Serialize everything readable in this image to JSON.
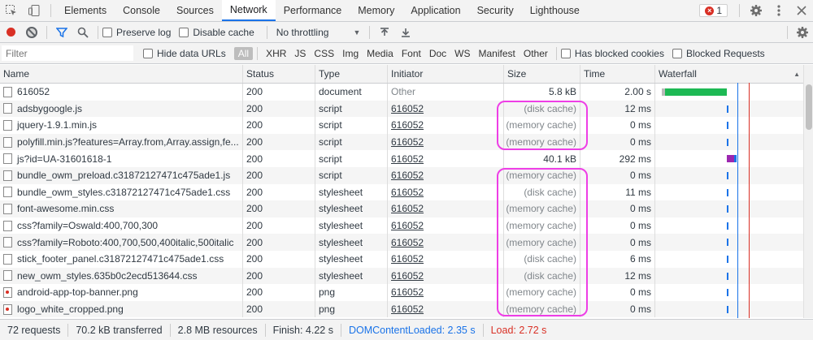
{
  "tabs": [
    "Elements",
    "Console",
    "Sources",
    "Network",
    "Performance",
    "Memory",
    "Application",
    "Security",
    "Lighthouse"
  ],
  "active_tab": "Network",
  "error_count": "1",
  "toolbar": {
    "preserve_log": "Preserve log",
    "disable_cache": "Disable cache",
    "throttling": "No throttling"
  },
  "filter": {
    "placeholder": "Filter",
    "hide_data_urls": "Hide data URLs",
    "types": [
      "All",
      "XHR",
      "JS",
      "CSS",
      "Img",
      "Media",
      "Font",
      "Doc",
      "WS",
      "Manifest",
      "Other"
    ],
    "has_blocked_cookies": "Has blocked cookies",
    "blocked_requests": "Blocked Requests"
  },
  "columns": {
    "name": "Name",
    "status": "Status",
    "type": "Type",
    "initiator": "Initiator",
    "size": "Size",
    "time": "Time",
    "waterfall": "Waterfall"
  },
  "requests": [
    {
      "name": "616052",
      "status": "200",
      "type": "document",
      "initiator": "Other",
      "size": "5.8 kB",
      "time": "2.00 s",
      "icon": "file-icon",
      "cached": false
    },
    {
      "name": "adsbygoogle.js",
      "status": "200",
      "type": "script",
      "initiator": "616052",
      "size": "(disk cache)",
      "time": "12 ms",
      "icon": "file-icon",
      "cached": true
    },
    {
      "name": "jquery-1.9.1.min.js",
      "status": "200",
      "type": "script",
      "initiator": "616052",
      "size": "(memory cache)",
      "time": "0 ms",
      "icon": "file-icon",
      "cached": true
    },
    {
      "name": "polyfill.min.js?features=Array.from,Array.assign,fe...",
      "status": "200",
      "type": "script",
      "initiator": "616052",
      "size": "(memory cache)",
      "time": "0 ms",
      "icon": "file-icon",
      "cached": true
    },
    {
      "name": "js?id=UA-31601618-1",
      "status": "200",
      "type": "script",
      "initiator": "616052",
      "size": "40.1 kB",
      "time": "292 ms",
      "icon": "file-icon",
      "cached": false
    },
    {
      "name": "bundle_owm_preload.c31872127471c475ade1.js",
      "status": "200",
      "type": "script",
      "initiator": "616052",
      "size": "(memory cache)",
      "time": "0 ms",
      "icon": "file-icon",
      "cached": true
    },
    {
      "name": "bundle_owm_styles.c31872127471c475ade1.css",
      "status": "200",
      "type": "stylesheet",
      "initiator": "616052",
      "size": "(disk cache)",
      "time": "11 ms",
      "icon": "file-icon",
      "cached": true
    },
    {
      "name": "font-awesome.min.css",
      "status": "200",
      "type": "stylesheet",
      "initiator": "616052",
      "size": "(memory cache)",
      "time": "0 ms",
      "icon": "file-icon",
      "cached": true
    },
    {
      "name": "css?family=Oswald:400,700,300",
      "status": "200",
      "type": "stylesheet",
      "initiator": "616052",
      "size": "(memory cache)",
      "time": "0 ms",
      "icon": "file-icon",
      "cached": true
    },
    {
      "name": "css?family=Roboto:400,700,500,400italic,500italic",
      "status": "200",
      "type": "stylesheet",
      "initiator": "616052",
      "size": "(memory cache)",
      "time": "0 ms",
      "icon": "file-icon",
      "cached": true
    },
    {
      "name": "stick_footer_panel.c31872127471c475ade1.css",
      "status": "200",
      "type": "stylesheet",
      "initiator": "616052",
      "size": "(disk cache)",
      "time": "6 ms",
      "icon": "file-icon",
      "cached": true
    },
    {
      "name": "new_owm_styles.635b0c2ecd513644.css",
      "status": "200",
      "type": "stylesheet",
      "initiator": "616052",
      "size": "(disk cache)",
      "time": "12 ms",
      "icon": "file-icon",
      "cached": true
    },
    {
      "name": "android-app-top-banner.png",
      "status": "200",
      "type": "png",
      "initiator": "616052",
      "size": "(memory cache)",
      "time": "0 ms",
      "icon": "image-file-icon",
      "cached": true
    },
    {
      "name": "logo_white_cropped.png",
      "status": "200",
      "type": "png",
      "initiator": "616052",
      "size": "(memory cache)",
      "time": "0 ms",
      "icon": "image-file-icon",
      "cached": true
    }
  ],
  "summary": {
    "requests": "72 requests",
    "transferred": "70.2 kB transferred",
    "resources": "2.8 MB resources",
    "finish": "Finish: 4.22 s",
    "dom_content_loaded": "DOMContentLoaded: 2.35 s",
    "load": "Load: 2.72 s"
  },
  "colors": {
    "accent": "#1a73e8",
    "record": "#d93025",
    "highlight": "#ee3ee6",
    "waterfall_green": "#1db954",
    "waterfall_purple": "#9c27b0"
  }
}
